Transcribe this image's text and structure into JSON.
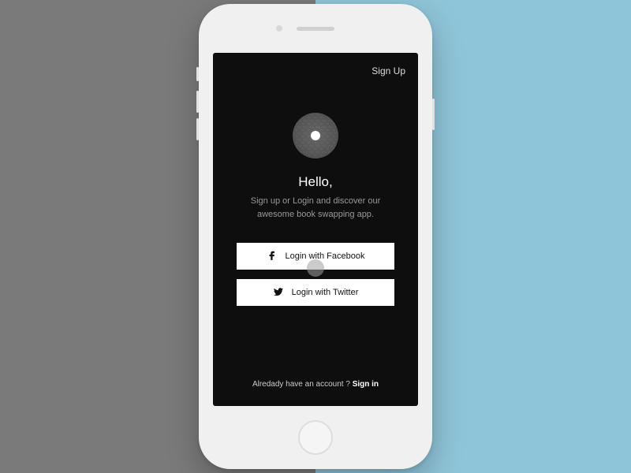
{
  "header": {
    "sign_up_label": "Sign Up"
  },
  "content": {
    "greeting": "Hello,",
    "subtitle_line1": "Sign up or Login and discover our",
    "subtitle_line2": "awesome book swapping app."
  },
  "buttons": {
    "facebook_label": "Login with Facebook",
    "twitter_label": "Login with Twitter"
  },
  "footer": {
    "prompt": "Alredady have an account ? ",
    "signin_label": "Sign in"
  },
  "colors": {
    "bg_left": "#7a7a7a",
    "bg_right": "#8fc5d9",
    "screen": "#0e0e0e"
  }
}
